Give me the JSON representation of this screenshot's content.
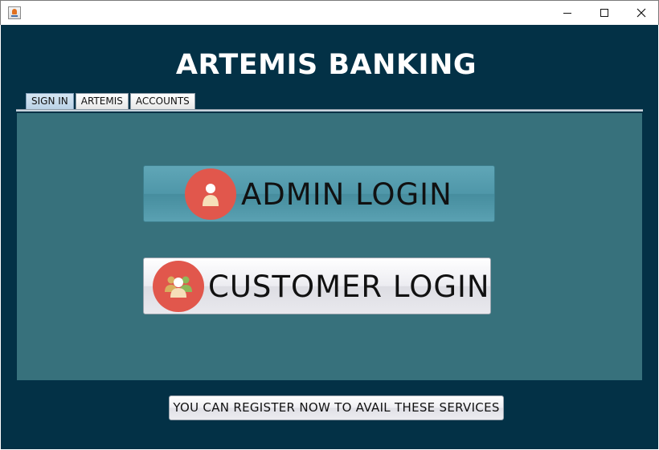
{
  "window": {
    "icon": "java-cup-icon",
    "controls": [
      "minimize-icon",
      "maximize-icon",
      "close-icon"
    ]
  },
  "app": {
    "title": "ARTEMIS BANKING"
  },
  "tabs": [
    {
      "label": "SIGN IN",
      "selected": true
    },
    {
      "label": "ARTEMIS",
      "selected": false
    },
    {
      "label": "ACCOUNTS",
      "selected": false
    }
  ],
  "main": {
    "admin_login": {
      "label": "ADMIN LOGIN",
      "icon": "admin-user-icon"
    },
    "customer_login": {
      "label": "CUSTOMER LOGIN",
      "icon": "customers-group-icon"
    }
  },
  "register": {
    "label": "YOU CAN REGISTER NOW TO AVAIL THESE SERVICES"
  },
  "colors": {
    "frame_bg": "#033146",
    "panel_bg": "#37717c",
    "admin_button": "#4f97a9",
    "icon_circle": "#e1574c"
  }
}
